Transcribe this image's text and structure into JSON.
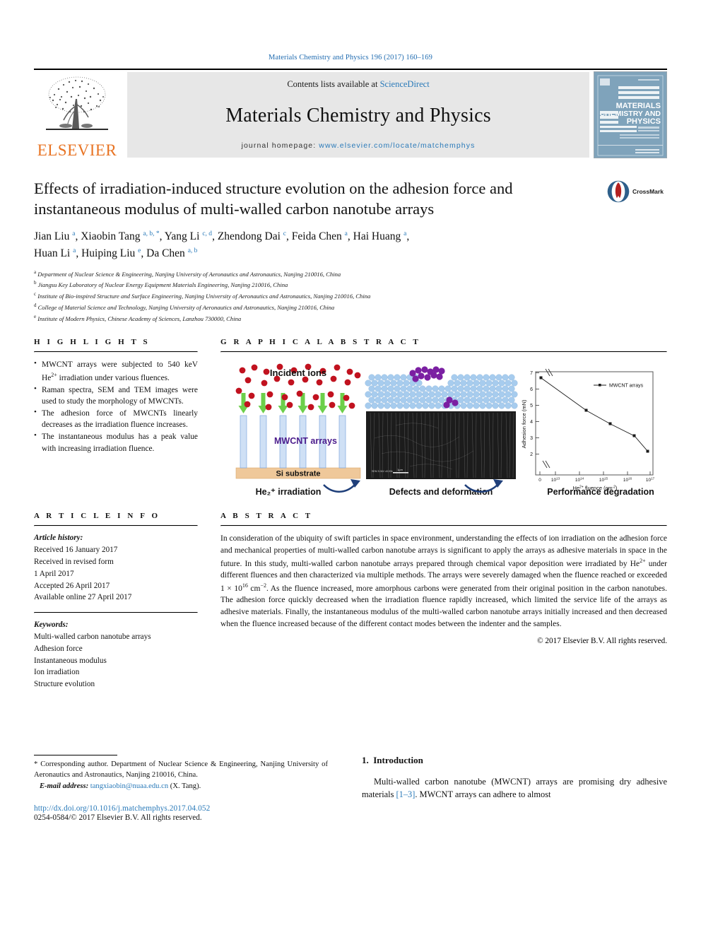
{
  "running_head": "Materials Chemistry and Physics 196 (2017) 160–169",
  "masthead": {
    "publisher": "ELSEVIER",
    "contents_prefix": "Contents lists available at ",
    "contents_link": "ScienceDirect",
    "journal_title": "Materials Chemistry and Physics",
    "homepage_prefix": "journal homepage: ",
    "homepage_url": "www.elsevier.com/locate/matchemphys",
    "cover_line1": "MATERIALS",
    "cover_line2": "CHEMISTRY AND",
    "cover_line3": "PHYSICS"
  },
  "article": {
    "title": "Effects of irradiation-induced structure evolution on the adhesion force and instantaneous modulus of multi-walled carbon nanotube arrays",
    "crossmark_label": "CrossMark",
    "authors_line1_parts": [
      {
        "name": "Jian Liu ",
        "sup": "a"
      },
      {
        "name": ", Xiaobin Tang ",
        "sup": "a, b, *"
      },
      {
        "name": ", Yang Li ",
        "sup": "c, d"
      },
      {
        "name": ", Zhendong Dai ",
        "sup": "c"
      },
      {
        "name": ", Feida Chen ",
        "sup": "a"
      },
      {
        "name": ", Hai Huang ",
        "sup": "a"
      },
      {
        "name": ",",
        "sup": ""
      }
    ],
    "authors_line2_parts": [
      {
        "name": "Huan Li ",
        "sup": "a"
      },
      {
        "name": ", Huiping Liu ",
        "sup": "e"
      },
      {
        "name": ", Da Chen ",
        "sup": "a, b"
      }
    ],
    "affiliations": [
      {
        "key": "a",
        "text": "Department of Nuclear Science & Engineering, Nanjing University of Aeronautics and Astronautics, Nanjing 210016, China"
      },
      {
        "key": "b",
        "text": "Jiangsu Key Laboratory of Nuclear Energy Equipment Materials Engineering, Nanjing 210016, China"
      },
      {
        "key": "c",
        "text": "Institute of Bio-inspired Structure and Surface Engineering, Nanjing University of Aeronautics and Astronautics, Nanjing 210016, China"
      },
      {
        "key": "d",
        "text": "College of Material Science and Technology, Nanjing University of Aeronautics and Astronautics, Nanjing 210016, China"
      },
      {
        "key": "e",
        "text": "Institute of Modern Physics, Chinese Academy of Sciences, Lanzhou 730000, China"
      }
    ]
  },
  "highlights": {
    "heading": "H I G H L I G H T S",
    "items": [
      "MWCNT arrays were subjected to 540 keV He2+ irradiation under various fluences.",
      "Raman spectra, SEM and TEM images were used to study the morphology of MWCNTs.",
      "The adhesion force of MWCNTs linearly decreases as the irradiation fluence increases.",
      "The instantaneous modulus has a peak value with increasing irradiation fluence."
    ]
  },
  "graphical_abstract": {
    "heading": "G R A P H I C A L   A B S T R A C T",
    "panel1": {
      "label_ions": "Incident ions",
      "label_arrays": "MWCNT arrays",
      "label_substrate": "Si substrate",
      "caption": "He2+ irradiation",
      "ion_color": "#c1121f",
      "arrow_color": "#6ccf4a",
      "tube_color": "#aac8ee",
      "substrate_color": "#efc89a"
    },
    "panel2": {
      "caption": "Defects and deformation",
      "lattice_color": "#9ec6ea",
      "defect_color": "#7b1fa2",
      "sem_scalebar": "1 μm"
    },
    "panel3": {
      "caption": "Performance degradation"
    },
    "arrow_color": "#1f3f7a"
  },
  "chart_data": {
    "type": "line",
    "title": "",
    "xlabel": "He2+ fluence (cm-2)",
    "ylabel": "Adhesion force (mN)",
    "legend": [
      "MWCNT arrays"
    ],
    "legend_position": "top-right",
    "x_tick_labels": [
      "0",
      "10^13",
      "10^14",
      "10^15",
      "10^16",
      "10^17"
    ],
    "y_tick_labels": [
      "2",
      "3",
      "4",
      "5",
      "6",
      "7"
    ],
    "ylim": [
      1.6,
      7.0
    ],
    "grid": false,
    "axis_break_x": true,
    "axis_break_y": true,
    "points": [
      {
        "x_label": "0",
        "y": 6.65
      },
      {
        "x_label": "1e14",
        "y": 4.63
      },
      {
        "x_label": "1e15",
        "y": 3.8
      },
      {
        "x_label": "1e16",
        "y": 3.07
      },
      {
        "x_label": "5e16",
        "y": 2.1
      }
    ]
  },
  "article_info": {
    "heading": "A R T I C L E   I N F O",
    "history_label": "Article history:",
    "history": [
      "Received 16 January 2017",
      "Received in revised form",
      "1 April 2017",
      "Accepted 26 April 2017",
      "Available online 27 April 2017"
    ],
    "keywords_label": "Keywords:",
    "keywords": [
      "Multi-walled carbon nanotube arrays",
      "Adhesion force",
      "Instantaneous modulus",
      "Ion irradiation",
      "Structure evolution"
    ]
  },
  "abstract": {
    "heading": "A B S T R A C T",
    "paragraph_pre": "In consideration of the ubiquity of swift particles in space environment, understanding the effects of ion irradiation on the adhesion force and mechanical properties of multi-walled carbon nanotube arrays is significant to apply the arrays as adhesive materials in space in the future. In this study, multi-walled carbon nanotube arrays prepared through chemical vapor deposition were irradiated by He",
    "sup1": "2+",
    "paragraph_mid": " under different fluences and then characterized via multiple methods. The arrays were severely damaged when the fluence reached or exceeded 1 × 10",
    "sup2": "16",
    "paragraph_mid2": " cm",
    "sup3": "−2",
    "paragraph_post": ". As the fluence increased, more amorphous carbons were generated from their original position in the carbon nanotubes. The adhesion force quickly decreased when the irradiation fluence rapidly increased, which limited the service life of the arrays as adhesive materials. Finally, the instantaneous modulus of the multi-walled carbon nanotube arrays initially increased and then decreased when the fluence increased because of the different contact modes between the indenter and the samples.",
    "copyright": "© 2017 Elsevier B.V. All rights reserved."
  },
  "footer": {
    "corresponding_star": "*",
    "corresponding_text": " Corresponding author. Department of Nuclear Science & Engineering, Nanjing University of Aeronautics and Astronautics, Nanjing 210016, China.",
    "email_label": "E-mail address:",
    "email": "tangxiaobin@nuaa.edu.cn",
    "email_attrib": " (X. Tang).",
    "doi": "http://dx.doi.org/10.1016/j.matchemphys.2017.04.052",
    "issn": "0254-0584/© 2017 Elsevier B.V. All rights reserved."
  },
  "introduction": {
    "section_number": "1.",
    "section_title": "Introduction",
    "text_pre": "Multi-walled carbon nanotube (MWCNT) arrays are promising dry adhesive materials ",
    "ref": "[1–3]",
    "text_post": ". MWCNT arrays can adhere to almost"
  }
}
